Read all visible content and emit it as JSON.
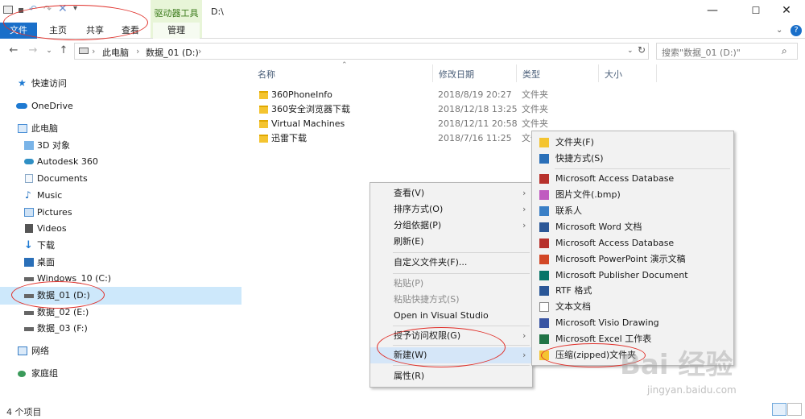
{
  "window": {
    "context_tab_title": "驱动器工具",
    "path_title": "D:\\",
    "controls": [
      "—",
      "☐",
      "✕"
    ]
  },
  "ribbon": {
    "tabs": [
      "文件",
      "主页",
      "共享",
      "查看",
      "管理"
    ],
    "help_icon": "?"
  },
  "address": {
    "crumbs": [
      "此电脑",
      "数据_01 (D:)"
    ],
    "search_placeholder": "搜索\"数据_01 (D:)\""
  },
  "sidebar": {
    "items": [
      {
        "label": "快速访问",
        "icon": "star-icon",
        "color": "#1e7ad2"
      },
      {
        "label": "OneDrive",
        "icon": "cloud-icon",
        "color": "#1e7ad2"
      },
      {
        "label": "此电脑",
        "icon": "computer-icon",
        "color": "#4a8fd6"
      },
      {
        "label": "3D 对象",
        "icon": "cube-icon",
        "color": "#7ab4e8"
      },
      {
        "label": "Autodesk 360",
        "icon": "autodesk-icon",
        "color": "#2f8fc4"
      },
      {
        "label": "Documents",
        "icon": "document-icon",
        "color": "#8aa9c8"
      },
      {
        "label": "Music",
        "icon": "music-icon",
        "color": "#1e6fc0"
      },
      {
        "label": "Pictures",
        "icon": "picture-icon",
        "color": "#4d8fd0"
      },
      {
        "label": "Videos",
        "icon": "video-icon",
        "color": "#555555"
      },
      {
        "label": "下载",
        "icon": "download-icon",
        "color": "#1e7ad2"
      },
      {
        "label": "桌面",
        "icon": "desktop-icon",
        "color": "#2a6fb8"
      },
      {
        "label": "Windows_10 (C:)",
        "icon": "drive-icon",
        "color": "#666666"
      },
      {
        "label": "数据_01 (D:)",
        "icon": "drive-icon",
        "color": "#666666"
      },
      {
        "label": "数据_02 (E:)",
        "icon": "drive-icon",
        "color": "#666666"
      },
      {
        "label": "数据_03 (F:)",
        "icon": "drive-icon",
        "color": "#666666"
      },
      {
        "label": "网络",
        "icon": "network-icon",
        "color": "#3a7fc6"
      },
      {
        "label": "家庭组",
        "icon": "homegroup-icon",
        "color": "#3a9a5a"
      }
    ]
  },
  "columns": {
    "name": "名称",
    "date": "修改日期",
    "type": "类型",
    "size": "大小"
  },
  "files": [
    {
      "name": "360PhoneInfo",
      "date": "2018/8/19 20:27",
      "type": "文件夹"
    },
    {
      "name": "360安全浏览器下载",
      "date": "2018/12/18 13:25",
      "type": "文件夹"
    },
    {
      "name": "Virtual Machines",
      "date": "2018/12/11 20:58",
      "type": "文件夹"
    },
    {
      "name": "迅雷下载",
      "date": "2018/7/16 11:25",
      "type": "文件夹"
    }
  ],
  "context_menu": {
    "items": [
      {
        "label": "查看(V)",
        "submenu": true,
        "disabled": false
      },
      {
        "label": "排序方式(O)",
        "submenu": true,
        "disabled": false
      },
      {
        "label": "分组依据(P)",
        "submenu": true,
        "disabled": false
      },
      {
        "label": "刷新(E)",
        "submenu": false,
        "disabled": false
      },
      {
        "label": "自定义文件夹(F)...",
        "submenu": false,
        "disabled": false
      },
      {
        "label": "粘贴(P)",
        "submenu": false,
        "disabled": true
      },
      {
        "label": "粘贴快捷方式(S)",
        "submenu": false,
        "disabled": true
      },
      {
        "label": "Open in Visual Studio",
        "submenu": false,
        "disabled": false
      },
      {
        "label": "授予访问权限(G)",
        "submenu": true,
        "disabled": false
      },
      {
        "label": "新建(W)",
        "submenu": true,
        "disabled": false
      },
      {
        "label": "属性(R)",
        "submenu": false,
        "disabled": false
      }
    ]
  },
  "new_submenu": {
    "items": [
      {
        "label": "文件夹(F)",
        "icon": "folder-icon",
        "color": "#f4c430"
      },
      {
        "label": "快捷方式(S)",
        "icon": "shortcut-icon",
        "color": "#2a6fb8"
      },
      {
        "label": "Microsoft Access Database",
        "icon": "access-icon",
        "color": "#b7312c"
      },
      {
        "label": "图片文件(.bmp)",
        "icon": "bitmap-icon",
        "color": "#c05ac0"
      },
      {
        "label": "联系人",
        "icon": "contact-icon",
        "color": "#3a7fc6"
      },
      {
        "label": "Microsoft Word 文档",
        "icon": "word-icon",
        "color": "#2b5797"
      },
      {
        "label": "Microsoft Access Database",
        "icon": "access-icon",
        "color": "#b7312c"
      },
      {
        "label": "Microsoft PowerPoint 演示文稿",
        "icon": "powerpoint-icon",
        "color": "#d24726"
      },
      {
        "label": "Microsoft Publisher Document",
        "icon": "publisher-icon",
        "color": "#077568"
      },
      {
        "label": "RTF 格式",
        "icon": "rtf-icon",
        "color": "#2b5797"
      },
      {
        "label": "文本文档",
        "icon": "text-icon",
        "color": "#888888"
      },
      {
        "label": "Microsoft Visio Drawing",
        "icon": "visio-icon",
        "color": "#3955a3"
      },
      {
        "label": "Microsoft Excel 工作表",
        "icon": "excel-icon",
        "color": "#217346"
      },
      {
        "label": "压缩(zipped)文件夹",
        "icon": "zip-folder-icon",
        "color": "#f4c430"
      }
    ]
  },
  "status": {
    "item_count": "4 个项目"
  },
  "watermark": {
    "brand": "Bai 经验",
    "url": "jingyan.baidu.com"
  }
}
